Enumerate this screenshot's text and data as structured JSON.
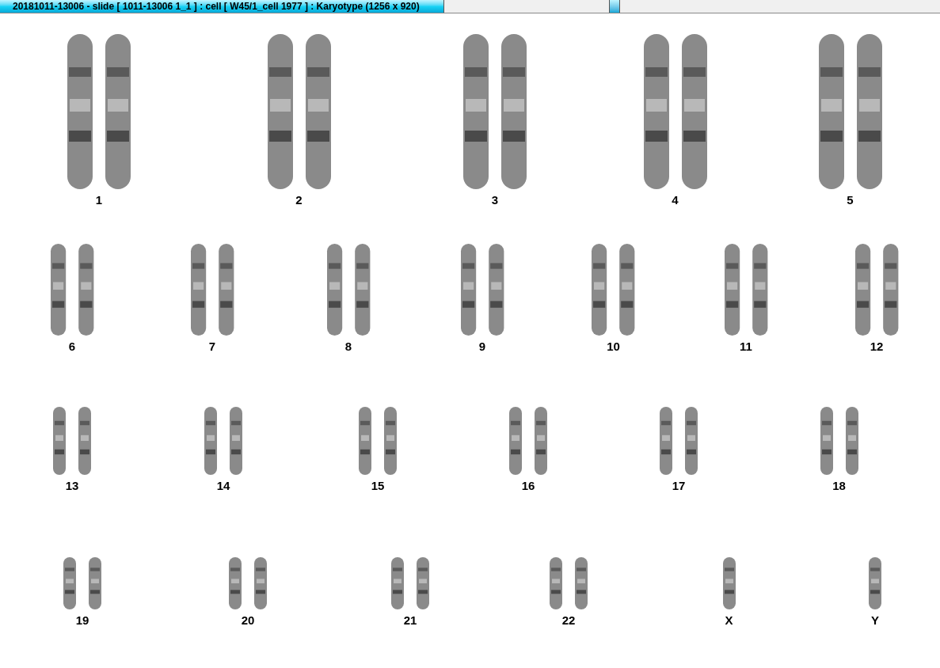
{
  "window": {
    "title": "20181011-13006 - slide [ 1011-13006 1_1 ] : cell [ W45/1_cell 1977 ] : Karyotype  (1256 x 920)"
  },
  "karyotype": {
    "rows": [
      {
        "groups": [
          {
            "label": "1",
            "kind": "pair"
          },
          {
            "label": "2",
            "kind": "pair"
          },
          {
            "label": "3",
            "kind": "pair"
          },
          {
            "label": "4",
            "kind": "pair"
          },
          {
            "label": "5",
            "kind": "pair"
          }
        ]
      },
      {
        "groups": [
          {
            "label": "6",
            "kind": "pair"
          },
          {
            "label": "7",
            "kind": "pair"
          },
          {
            "label": "8",
            "kind": "pair"
          },
          {
            "label": "9",
            "kind": "pair"
          },
          {
            "label": "10",
            "kind": "pair"
          },
          {
            "label": "11",
            "kind": "pair"
          },
          {
            "label": "12",
            "kind": "pair"
          }
        ]
      },
      {
        "groups": [
          {
            "label": "13",
            "kind": "pair"
          },
          {
            "label": "14",
            "kind": "pair"
          },
          {
            "label": "15",
            "kind": "pair"
          },
          {
            "label": "16",
            "kind": "pair"
          },
          {
            "label": "17",
            "kind": "pair"
          },
          {
            "label": "18",
            "kind": "pair"
          }
        ]
      },
      {
        "groups": [
          {
            "label": "19",
            "kind": "pair"
          },
          {
            "label": "20",
            "kind": "pair"
          },
          {
            "label": "21",
            "kind": "pair"
          },
          {
            "label": "22",
            "kind": "pair"
          },
          {
            "label": "X",
            "kind": "single"
          },
          {
            "label": "Y",
            "kind": "single"
          }
        ]
      }
    ]
  }
}
